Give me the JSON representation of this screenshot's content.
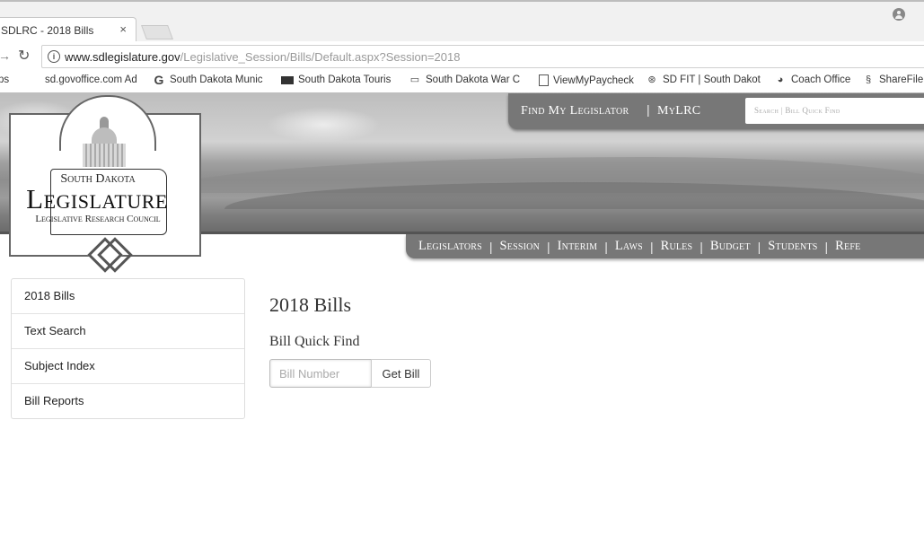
{
  "browser": {
    "tab_title": "SDLRC - 2018 Bills",
    "tab_close": "×",
    "url_host": "www.sdlegislature.gov",
    "url_path": "/Legislative_Session/Bills/Default.aspx?Session=2018",
    "bookmarks": [
      {
        "label": "ps",
        "icon": "none"
      },
      {
        "label": "sd.govoffice.com Ad",
        "icon": "none"
      },
      {
        "label": "South Dakota Munic",
        "icon": "google-icon"
      },
      {
        "label": "South Dakota Touris",
        "icon": "tourism-icon"
      },
      {
        "label": "South Dakota War C",
        "icon": "card-icon"
      },
      {
        "label": "ViewMyPaycheck",
        "icon": "document-icon"
      },
      {
        "label": "SD FIT | South Dakot",
        "icon": "sdfit-icon"
      },
      {
        "label": "Coach Office",
        "icon": "coach-icon"
      },
      {
        "label": "ShareFile",
        "icon": "sharefile-icon"
      }
    ]
  },
  "header": {
    "find_legislator": "Find My Legislator",
    "separator": "|",
    "mylrc": "MyLRC",
    "search_placeholder": "Search | Bill Quick Find"
  },
  "logo": {
    "line1": "South Dakota",
    "line2": "Legislature",
    "line3": "Legislative Research Council"
  },
  "mainnav": {
    "items": [
      "Legislators",
      "Session",
      "Interim",
      "Laws",
      "Rules",
      "Budget",
      "Students",
      "Refe"
    ]
  },
  "sidemenu": {
    "items": [
      "2018 Bills",
      "Text Search",
      "Subject Index",
      "Bill Reports"
    ]
  },
  "content": {
    "title": "2018 Bills",
    "subhead": "Bill Quick Find",
    "bill_placeholder": "Bill Number",
    "get_bill_label": "Get Bill"
  }
}
